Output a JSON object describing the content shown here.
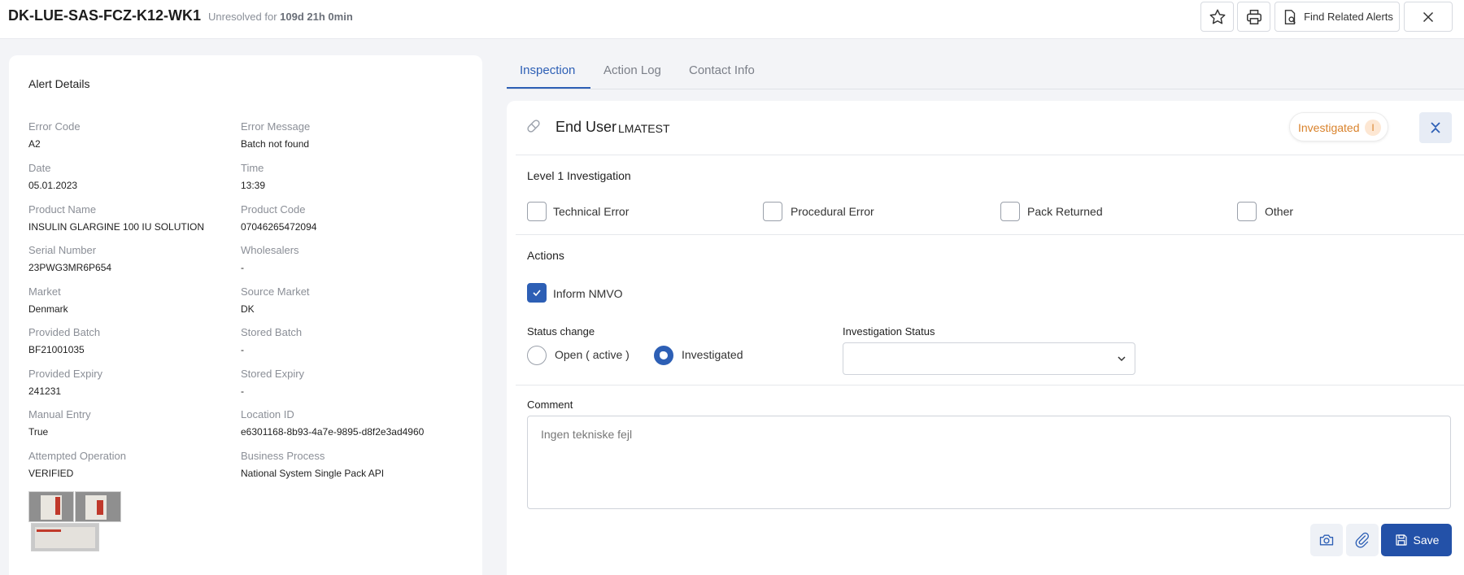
{
  "header": {
    "alert_id": "DK-LUE-SAS-FCZ-K12-WK1",
    "unresolved_prefix": "Unresolved for",
    "unresolved_duration": "109d 21h 0min",
    "find_related_label": "Find Related Alerts"
  },
  "alert_details": {
    "title": "Alert Details",
    "fields": [
      {
        "label": "Error Code",
        "value": "A2"
      },
      {
        "label": "Error Message",
        "value": "Batch not found"
      },
      {
        "label": "Date",
        "value": "05.01.2023"
      },
      {
        "label": "Time",
        "value": "13:39"
      },
      {
        "label": "Product Name",
        "value": "INSULIN GLARGINE 100 IU SOLUTION"
      },
      {
        "label": "Product Code",
        "value": "07046265472094"
      },
      {
        "label": "Serial Number",
        "value": "23PWG3MR6P654"
      },
      {
        "label": "Wholesalers",
        "value": "-"
      },
      {
        "label": "Market",
        "value": "Denmark"
      },
      {
        "label": "Source Market",
        "value": "DK"
      },
      {
        "label": "Provided Batch",
        "value": "BF21001035"
      },
      {
        "label": "Stored Batch",
        "value": "-"
      },
      {
        "label": "Provided Expiry",
        "value": "241231"
      },
      {
        "label": "Stored Expiry",
        "value": "-"
      },
      {
        "label": "Manual Entry",
        "value": "True"
      },
      {
        "label": "Location ID",
        "value": "e6301168-8b93-4a7e-9895-d8f2e3ad4960"
      },
      {
        "label": "Attempted Operation",
        "value": "VERIFIED"
      },
      {
        "label": "Business Process",
        "value": "National System Single Pack API"
      }
    ]
  },
  "tabs": [
    {
      "label": "Inspection",
      "active": true
    },
    {
      "label": "Action Log",
      "active": false
    },
    {
      "label": "Contact Info",
      "active": false
    }
  ],
  "inspection": {
    "title": "End User",
    "user": "LMATEST",
    "status_badge": "Investigated",
    "status_badge_mark": "I",
    "level1_label": "Level 1 Investigation",
    "level1_options": [
      {
        "label": "Technical Error",
        "checked": false
      },
      {
        "label": "Procedural Error",
        "checked": false
      },
      {
        "label": "Pack Returned",
        "checked": false
      },
      {
        "label": "Other",
        "checked": false
      }
    ],
    "actions_label": "Actions",
    "inform_nmvo_label": "Inform NMVO",
    "inform_nmvo_checked": true,
    "status_change_label": "Status change",
    "status_options": [
      {
        "label": "Open ( active )",
        "selected": false
      },
      {
        "label": "Investigated",
        "selected": true
      }
    ],
    "investigation_status_label": "Investigation Status",
    "investigation_status_value": "",
    "comment_label": "Comment",
    "comment_value": "Ingen tekniske fejl",
    "save_label": "Save"
  },
  "colors": {
    "accent": "#2d5fb5",
    "save_button": "#2351a8",
    "status_orange": "#d9822b"
  }
}
